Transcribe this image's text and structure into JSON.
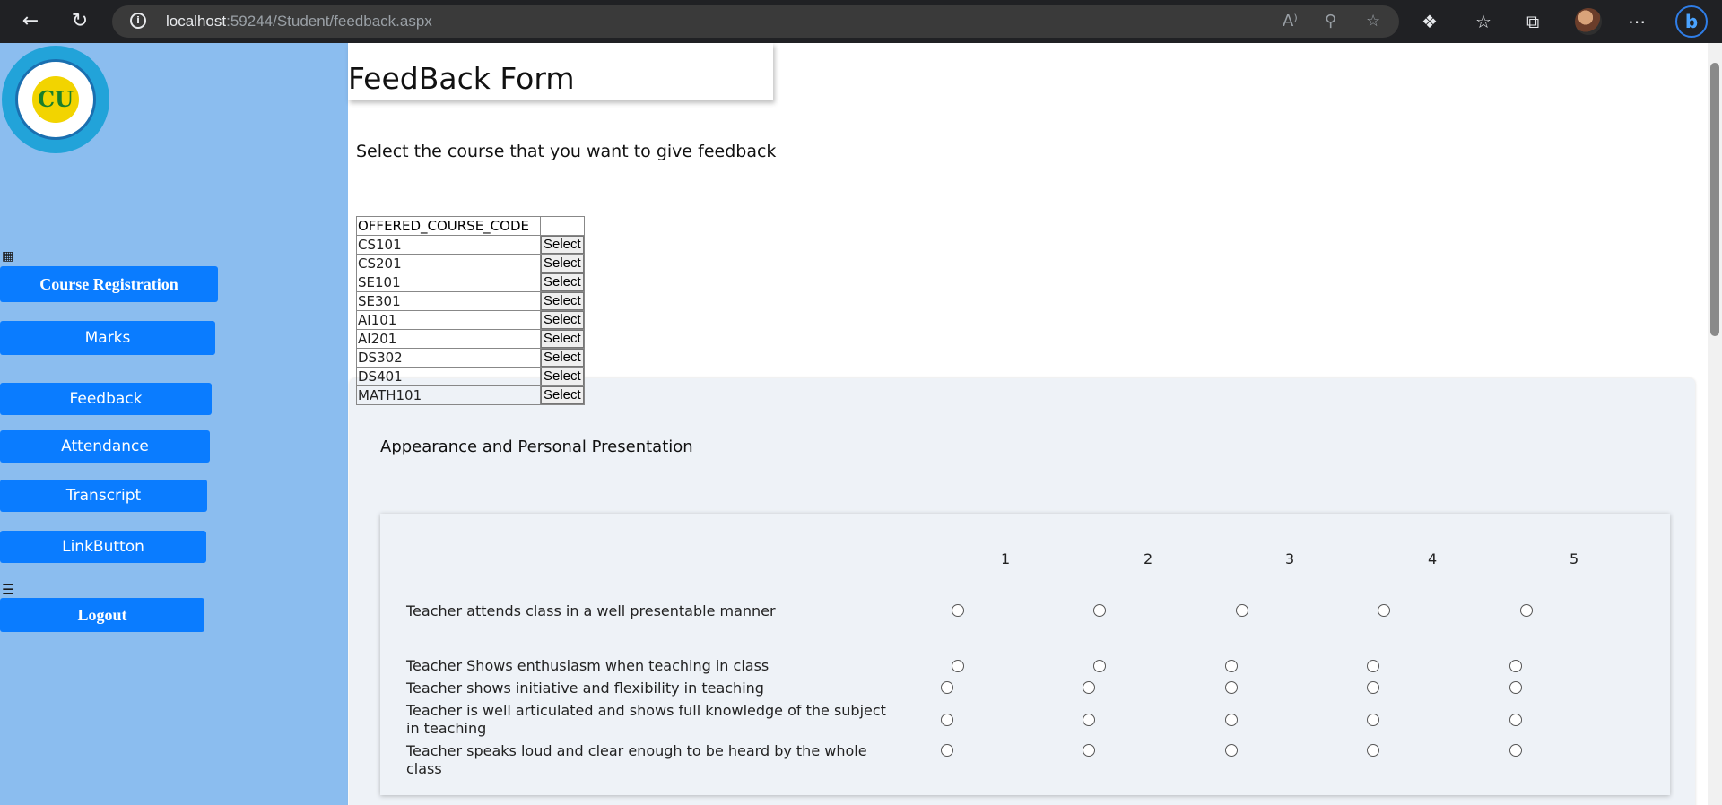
{
  "browser": {
    "url_host": "localhost",
    "url_path": ":59244/Student/feedback.aspx"
  },
  "sidebar": {
    "logo_text": "CU",
    "items": [
      {
        "label": "Course Registration"
      },
      {
        "label": "Marks"
      },
      {
        "label": "Feedback"
      },
      {
        "label": "Attendance"
      },
      {
        "label": "Transcript"
      },
      {
        "label": "LinkButton"
      },
      {
        "label": "Logout"
      }
    ]
  },
  "page": {
    "title": "FeedBack Form",
    "prompt": "Select the course that you want to give feedback"
  },
  "courses": {
    "header": "OFFERED_COURSE_CODE",
    "select_label": "Select",
    "rows": [
      "CS101",
      "CS201",
      "SE101",
      "SE301",
      "AI101",
      "AI201",
      "DS302",
      "DS401",
      "MATH101"
    ]
  },
  "section": {
    "title": "Appearance and Personal Presentation",
    "scale": [
      "1",
      "2",
      "3",
      "4",
      "5"
    ],
    "questions": [
      "Teacher attends class in a well presentable manner",
      "Teacher Shows enthusiasm when teaching in class",
      "Teacher shows initiative and flexibility in teaching",
      "Teacher is well articulated and shows full knowledge of the subject in teaching",
      "Teacher speaks loud and clear enough to be heard by the whole class"
    ]
  }
}
